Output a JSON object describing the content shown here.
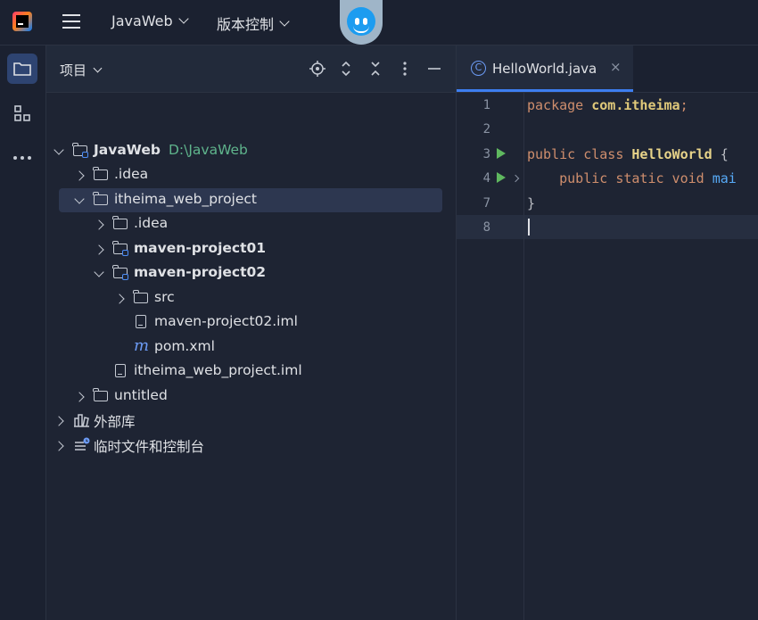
{
  "titlebar": {
    "project_menu": "JavaWeb",
    "vcs_menu": "版本控制"
  },
  "project_panel": {
    "title": "项目",
    "tree": [
      {
        "label": "JavaWeb",
        "path": "D:\\JavaWeb",
        "bold": true
      },
      {
        "label": ".idea"
      },
      {
        "label": "itheima_web_project"
      },
      {
        "label": ".idea"
      },
      {
        "label": "maven-project01",
        "bold": true
      },
      {
        "label": "maven-project02",
        "bold": true
      },
      {
        "label": "src"
      },
      {
        "label": "maven-project02.iml"
      },
      {
        "label": "pom.xml"
      },
      {
        "label": "itheima_web_project.iml"
      },
      {
        "label": "untitled"
      },
      {
        "label": "外部库"
      },
      {
        "label": "临时文件和控制台"
      }
    ]
  },
  "editor": {
    "tab": {
      "name": "HelloWorld.java",
      "icon": "C",
      "close": "×"
    },
    "line_numbers": [
      "1",
      "2",
      "3",
      "4",
      "7",
      "8"
    ],
    "code": {
      "l1_kw": "package ",
      "l1_pkg": "com.itheima",
      "l1_semi": ";",
      "l3_kw": "public class ",
      "l3_cls": "HelloWorld",
      "l3_rest": " {",
      "l4_kw": "    public static void ",
      "l4_fn": "mai",
      "l7": "}"
    }
  }
}
